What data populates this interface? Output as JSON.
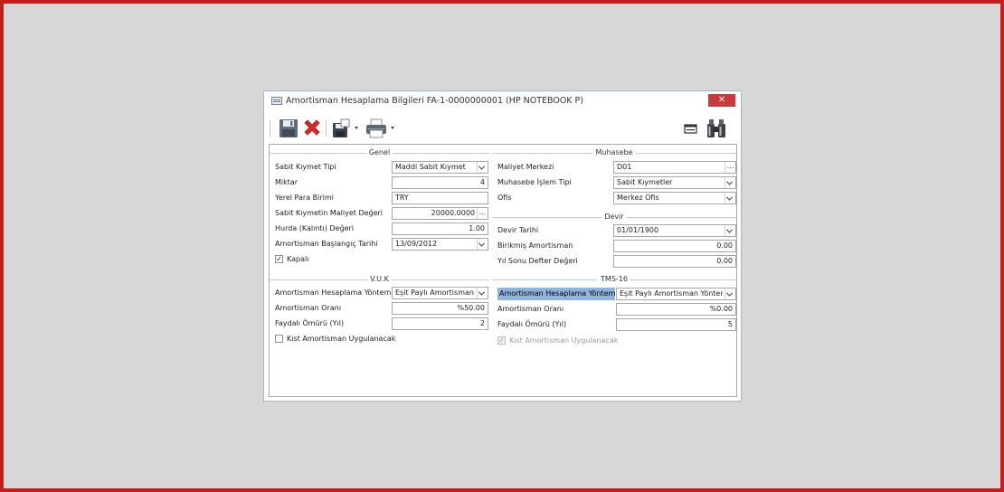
{
  "window": {
    "title": "Amortisman Hesaplama Bilgileri FA-1-0000000001 (HP NOTEBOOK P)",
    "close_glyph": "✕"
  },
  "toolbar": {
    "icons": [
      "save-icon",
      "delete-icon",
      "save-as-icon",
      "print-icon",
      "layout-icon",
      "binoculars-icon"
    ]
  },
  "genel": {
    "title": "Genel",
    "rows": [
      {
        "label": "Sabit Kıymet Tipi",
        "value": "Maddi Sabit Kıymet"
      },
      {
        "label": "Miktar",
        "value": "4"
      },
      {
        "label": "Yerel Para Birimi",
        "value": "TRY"
      },
      {
        "label": "Sabit Kıymetin Maliyet Değeri",
        "value": "20000.0000"
      },
      {
        "label": "Hurda (Kalıntı) Değeri",
        "value": "1.00"
      },
      {
        "label": "Amortisman Başlangıç Tarihi",
        "value": "13/09/2012"
      }
    ],
    "kapali": {
      "label": "Kapalı",
      "checked": true
    }
  },
  "muhasebe": {
    "title": "Muhasebe",
    "rows": [
      {
        "label": "Maliyet Merkezi",
        "value": "D01"
      },
      {
        "label": "Muhasebe İşlem Tipi",
        "value": "Sabit Kıymetler"
      },
      {
        "label": "Ofis",
        "value": "Merkez Ofis"
      }
    ]
  },
  "devir": {
    "title": "Devir",
    "rows": [
      {
        "label": "Devir Tarihi",
        "value": "01/01/1900"
      },
      {
        "label": "Birikmiş Amortisman",
        "value": "0.00"
      },
      {
        "label": "Yıl Sonu Defter Değeri",
        "value": "0.00"
      }
    ]
  },
  "vuk": {
    "title": "V.U.K",
    "rows": [
      {
        "label": "Amortisman Hesaplama Yöntemi",
        "value": "Eşit Paylı Amortisman..."
      },
      {
        "label": "Amortisman Oranı",
        "value": "%50.00"
      },
      {
        "label": "Faydalı Ömürü (Yıl)",
        "value": "2"
      }
    ],
    "kist": {
      "label": "Kıst Amortisman Uygulanacak",
      "checked": false
    }
  },
  "tms": {
    "title": "TMS-16",
    "rows": [
      {
        "label": "Amortisman Hesaplama Yöntemi",
        "value": "Eşit Paylı Amortisman Yöntemi"
      },
      {
        "label": "Amortisman Oranı",
        "value": "%0.00"
      },
      {
        "label": "Faydalı Ömürü (Yıl)",
        "value": "5"
      }
    ],
    "kist": {
      "label": "Kıst Amortisman Uygulanacak",
      "checked": true,
      "disabled": true
    }
  },
  "colors": {
    "frame_border": "#c61d1d",
    "highlight": "#8fb4de",
    "close_button": "#c73b3b"
  }
}
